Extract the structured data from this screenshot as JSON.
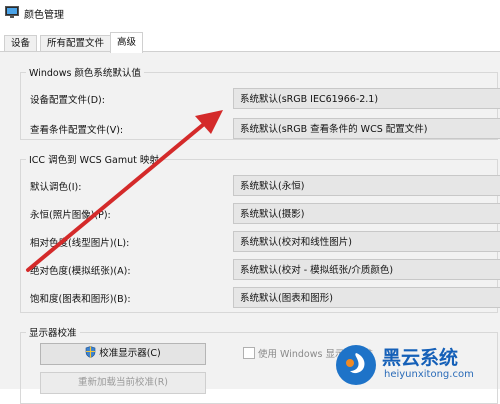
{
  "window": {
    "title": "颜色管理"
  },
  "tabs": [
    {
      "label": "设备"
    },
    {
      "label": "所有配置文件"
    },
    {
      "label": "高级"
    }
  ],
  "windows_defaults": {
    "group_title": "Windows 颜色系统默认值",
    "device_profile_label": "设备配置文件(D):",
    "device_profile_value": "系统默认(sRGB IEC61966-2.1)",
    "viewing_profile_label": "查看条件配置文件(V):",
    "viewing_profile_value": "系统默认(sRGB 查看条件的 WCS 配置文件)"
  },
  "icc_mapping": {
    "group_title": "ICC 调色到 WCS Gamut 映射",
    "rows": [
      {
        "label": "默认调色(I):",
        "value": "系统默认(永恒)"
      },
      {
        "label": "永恒(照片图像)(P):",
        "value": "系统默认(摄影)"
      },
      {
        "label": "相对色度(线型图片)(L):",
        "value": "系统默认(校对和线性图片)"
      },
      {
        "label": "绝对色度(模拟纸张)(A):",
        "value": "系统默认(校对 - 模拟纸张/介质颜色)"
      },
      {
        "label": "饱和度(图表和图形)(B):",
        "value": "系统默认(图表和图形)"
      }
    ]
  },
  "calibration": {
    "group_title": "显示器校准",
    "calibrate_button": "校准显示器(C)",
    "use_windows_checkbox": "使用 Windows 显示器校准",
    "reload_button": "重新加载当前校准(R)"
  },
  "watermark": {
    "brand": "黑云系统",
    "url": "heiyunxitong.com"
  },
  "colors": {
    "arrow": "#d42a2a",
    "watermark": "#1560b8"
  }
}
